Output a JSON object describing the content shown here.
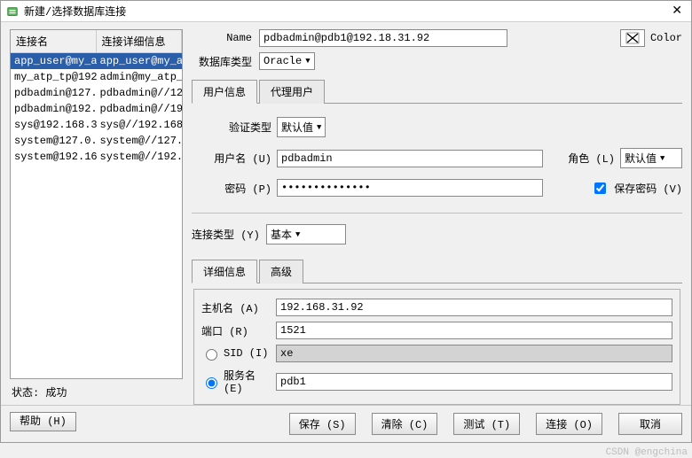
{
  "window": {
    "title": "新建/选择数据库连接"
  },
  "left": {
    "headers": {
      "name": "连接名",
      "details": "连接详细信息"
    },
    "rows": [
      {
        "name": "app_user@my_a..",
        "details": "app_user@my_a.."
      },
      {
        "name": "my_atp_tp@192..",
        "details": "admin@my_atp_tp"
      },
      {
        "name": "pdbadmin@127..",
        "details": "pdbadmin@//12.."
      },
      {
        "name": "pdbadmin@192..",
        "details": "pdbadmin@//19.."
      },
      {
        "name": "sys@192.168.3..",
        "details": "sys@//192.168.."
      },
      {
        "name": "system@127.0..",
        "details": "system@//127.."
      },
      {
        "name": "system@192.16..",
        "details": "system@//192.."
      }
    ],
    "status": {
      "label": "状态:",
      "value": "成功"
    }
  },
  "form": {
    "name_label": "Name",
    "name_value": "pdbadmin@pdb1@192.18.31.92",
    "color_label": "Color",
    "dbtype_label": "数据库类型",
    "dbtype_value": "Oracle",
    "tabs": {
      "user": "用户信息",
      "proxy": "代理用户"
    },
    "auth_label": "验证类型",
    "auth_value": "默认值",
    "user_label": "用户名 (U)",
    "user_value": "pdbadmin",
    "role_label": "角色 (L)",
    "role_value": "默认值",
    "password_label": "密码 (P)",
    "password_value": "••••••••••••••",
    "savepw_label": "保存密码 (V)",
    "conntype_label": "连接类型 (Y)",
    "conntype_value": "基本",
    "subtabs": {
      "detail": "详细信息",
      "advanced": "高级"
    },
    "hostname_label": "主机名 (A)",
    "hostname_value": "192.168.31.92",
    "port_label": "端口 (R)",
    "port_value": "1521",
    "sid_label": "SID (I)",
    "sid_value": "xe",
    "service_label": "服务名 (E)",
    "service_value": "pdb1"
  },
  "footer": {
    "help": "帮助 (H)",
    "save": "保存 (S)",
    "clear": "清除 (C)",
    "test": "测试 (T)",
    "connect": "连接 (O)",
    "cancel": "取消"
  },
  "watermark": "CSDN @engchina"
}
